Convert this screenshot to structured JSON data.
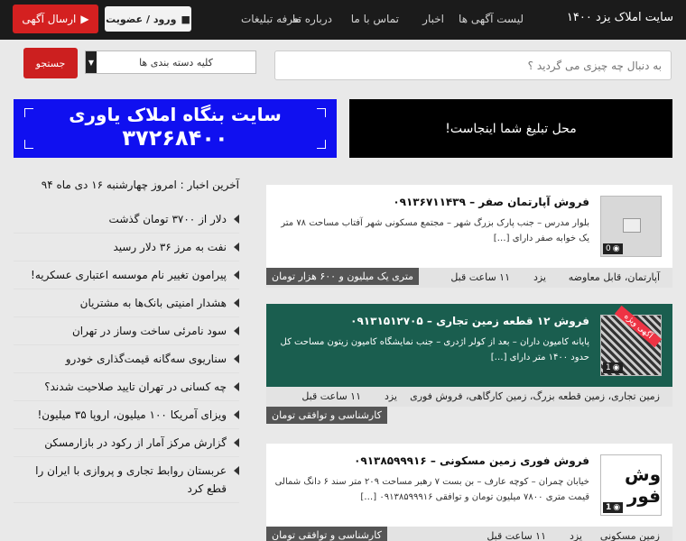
{
  "header": {
    "site_title": "سایت املاک یزد ۱۴۰۰",
    "nav": [
      "لیست آگهی ها",
      "اخبار",
      "تماس با ما",
      "درباره ما",
      "تعرفه تبلیغات"
    ],
    "login_label": "ورود / عضویت",
    "post_ad_label": "ارسال آگهی"
  },
  "search": {
    "placeholder": "به دنبال چه چیزی می گردید ؟",
    "category": "کلیه دسته بندی ها",
    "button": "جستجو"
  },
  "banners": {
    "ad_space": "محل تبلیغ شما اینجاست!",
    "agency_name": "سایت بنگاه املاک یاوری",
    "agency_phone": "۳۷۲۶۸۴۰۰"
  },
  "news": {
    "heading": "آخرین اخبار : امروز چهارشنبه ۱۶ دی ماه ۹۴",
    "items": [
      "دلار از ۳۷۰۰ تومان گذشت",
      "نفت به مرز ۳۶ دلار رسید",
      "پیرامون تغییر نام موسسه اعتباری عسکریه!",
      "هشدار امنیتی بانک‌ها به مشتریان",
      "سود نامرئی ساخت وساز در تهران",
      "سناریوی سه‌گانه قیمت‌گذاری خودرو",
      "چه کسانی در تهران تایید صلاحیت شدند؟",
      "ویزای آمریکا ۱۰۰ میلیون، اروپا ۳۵ میلیون!",
      "گزارش مرکز آمار از رکود در بازارمسکن",
      "عربستان روابط تجاری و پروازی با ایران را قطع کرد"
    ]
  },
  "listings": [
    {
      "title": "فروش آپارتمان صفر – ۰۹۱۳۶۷۱۱۴۳۹",
      "desc": "بلوار مدرس – جنب پارک بزرگ شهر – مجتمع مسکونی شهر آفتاب مساحت ۷۸ متر یک خوابه صفر دارای […]",
      "photo_count": "0",
      "category": "آپارتمان، قابل معاوضه",
      "city": "یزد",
      "time": "۱۱ ساعت قبل",
      "price": "متری یک میلیون و ۶۰۰ هزار تومان"
    },
    {
      "title": "فروش ۱۲ قطعه زمین تجاری – ۰۹۱۳۱۵۱۲۷۰۵",
      "desc": "پایانه کامیون داران – بعد از کولر اژدری – جنب نمایشگاه کامیون زیتون مساحت کل حدود ۱۴۰۰ متر دارای […]",
      "photo_count": "1",
      "ribbon": "آگهی ویژه",
      "category": "زمین تجاری، زمین قطعه بزرگ، زمین کارگاهی، فروش فوری",
      "city": "یزد",
      "time": "۱۱ ساعت قبل",
      "price": "کارشناسی و توافقی تومان"
    },
    {
      "title": "فروش فوری زمین مسکونی – ۰۹۱۳۸۵۹۹۹۱۶",
      "desc": "خیابان چمران – کوچه عارف – بن بست ۷ رهبر مساحت ۲۰۹ متر سند ۶ دانگ شمالی قیمت متری ۷۸۰۰ میلیون تومان و توافقی ۰۹۱۳۸۵۹۹۹۱۶ […]",
      "photo_count": "1",
      "thumb_text": "وش فور",
      "category": "زمین مسکونی",
      "city": "یزد",
      "time": "۱۱ ساعت قبل",
      "price": "کارشناسی و توافقی تومان"
    }
  ]
}
